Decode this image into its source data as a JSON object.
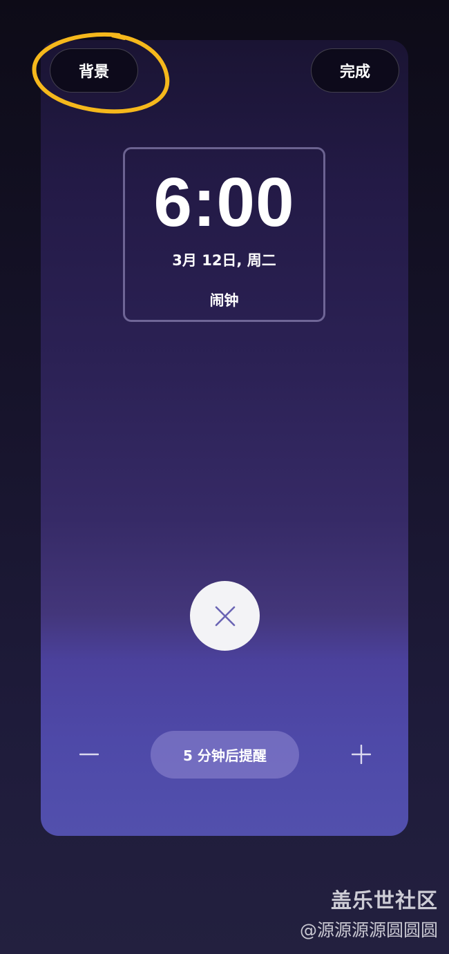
{
  "header": {
    "background_label": "背景",
    "done_label": "完成"
  },
  "clock": {
    "time": "6:00",
    "date": "3月 12日, 周二",
    "label": "闹钟"
  },
  "actions": {
    "dismiss_icon": "close-icon",
    "snooze_label": "5 分钟后提醒",
    "minus_icon": "minus-icon",
    "plus_icon": "plus-icon"
  },
  "watermark": {
    "title": "盖乐世社区",
    "user": "@源源源源圆圆圆"
  },
  "colors": {
    "highlight": "#f5b81c",
    "card_top": "#1a1433",
    "card_bottom": "#5250ad",
    "dismiss_x": "#6a64b4"
  }
}
